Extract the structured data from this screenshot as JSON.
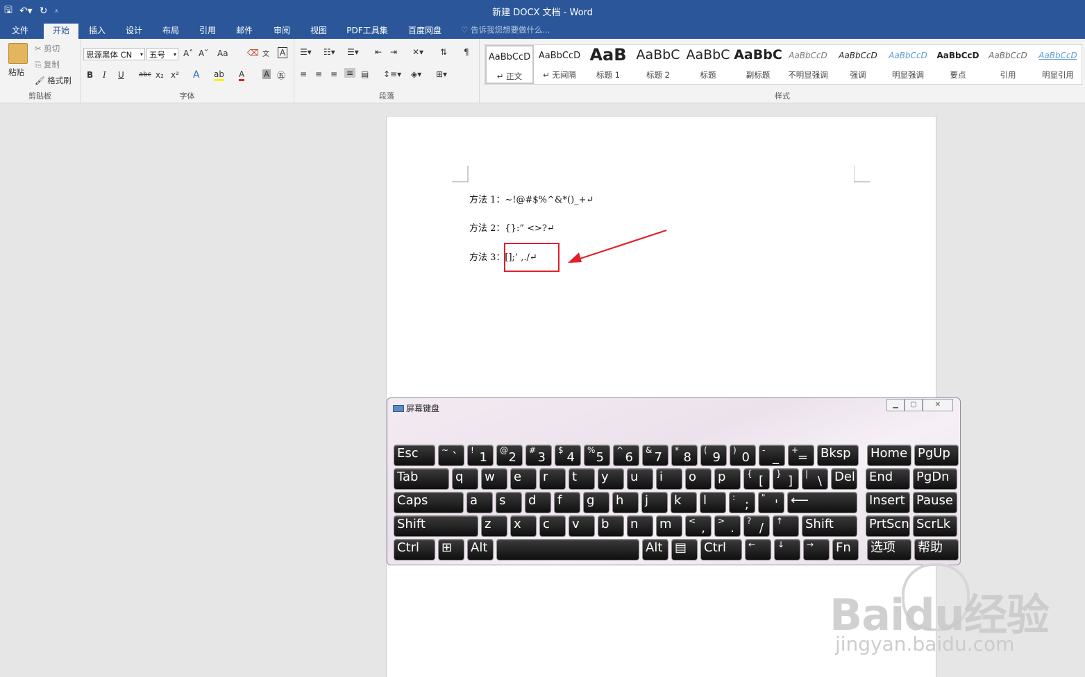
{
  "window": {
    "title": "新建 DOCX 文档 - Word"
  },
  "qat": {
    "save": "🖫",
    "undo": "↶▾",
    "redo": "↻",
    "more": "⩡"
  },
  "tabs": [
    "文件",
    "开始",
    "插入",
    "设计",
    "布局",
    "引用",
    "邮件",
    "审阅",
    "视图",
    "PDF工具集",
    "百度网盘"
  ],
  "tell_me": "告诉我您想要做什么...",
  "ribbon": {
    "clipboard": {
      "paste": "粘贴",
      "cut": "剪切",
      "copy": "复制",
      "format_painter": "格式刷",
      "label": "剪贴板"
    },
    "font": {
      "name": "思源黑体 CN",
      "size": "五号",
      "label": "字体",
      "grow": "A˄",
      "shrink": "A˅",
      "case": "Aa",
      "bold": "B",
      "italic": "I",
      "underline": "U",
      "strike": "abc",
      "sub": "x₂",
      "sup": "x²"
    },
    "paragraph": {
      "label": "段落"
    },
    "styles": {
      "label": "样式",
      "items": [
        {
          "preview": "AaBbCcD",
          "name": "↵ 正文"
        },
        {
          "preview": "AaBbCcD",
          "name": "↵ 无间隔"
        },
        {
          "preview": "AaB",
          "name": "标题 1"
        },
        {
          "preview": "AaBbC",
          "name": "标题 2"
        },
        {
          "preview": "AaBbC",
          "name": "标题"
        },
        {
          "preview": "AaBbC",
          "name": "副标题"
        },
        {
          "preview": "AaBbCcD",
          "name": "不明显强调"
        },
        {
          "preview": "AaBbCcD",
          "name": "强调"
        },
        {
          "preview": "AaBbCcD",
          "name": "明显强调"
        },
        {
          "preview": "AaBbCcD",
          "name": "要点"
        },
        {
          "preview": "AaBbCcD",
          "name": "引用"
        },
        {
          "preview": "AaBbCcD",
          "name": "明显引用"
        }
      ]
    }
  },
  "document": {
    "lines": [
      {
        "label": "方法 1：",
        "text": "~!@#$%^&*()_+↵"
      },
      {
        "label": "方法 2：",
        "text": "{}:” <>?↵"
      },
      {
        "label": "方法 3：",
        "text": "[];’ ,./↵"
      }
    ]
  },
  "osk": {
    "title": "屏幕键盘",
    "rows": [
      [
        {
          "m": "Esc"
        },
        {
          "s": "~",
          "b": "`"
        },
        {
          "s": "!",
          "b": "1"
        },
        {
          "s": "@",
          "b": "2"
        },
        {
          "s": "#",
          "b": "3"
        },
        {
          "s": "$",
          "b": "4"
        },
        {
          "s": "%",
          "b": "5"
        },
        {
          "s": "^",
          "b": "6"
        },
        {
          "s": "&",
          "b": "7"
        },
        {
          "s": "*",
          "b": "8"
        },
        {
          "s": "(",
          "b": "9"
        },
        {
          "s": ")",
          "b": "0"
        },
        {
          "s": "-",
          "b": "_"
        },
        {
          "s": "+",
          "b": "="
        },
        {
          "m": "Bksp"
        },
        {
          "m": "Home"
        },
        {
          "m": "PgUp"
        }
      ],
      [
        {
          "m": "Tab"
        },
        {
          "m": "q"
        },
        {
          "m": "w"
        },
        {
          "m": "e"
        },
        {
          "m": "r"
        },
        {
          "m": "t"
        },
        {
          "m": "y"
        },
        {
          "m": "u"
        },
        {
          "m": "i"
        },
        {
          "m": "o"
        },
        {
          "m": "p"
        },
        {
          "s": "{",
          "b": "["
        },
        {
          "s": "}",
          "b": "]"
        },
        {
          "s": "|",
          "b": "\\"
        },
        {
          "m": "Del"
        },
        {
          "m": "End"
        },
        {
          "m": "PgDn"
        }
      ],
      [
        {
          "m": "Caps"
        },
        {
          "m": "a"
        },
        {
          "m": "s"
        },
        {
          "m": "d"
        },
        {
          "m": "f"
        },
        {
          "m": "g"
        },
        {
          "m": "h"
        },
        {
          "m": "j"
        },
        {
          "m": "k"
        },
        {
          "m": "l"
        },
        {
          "s": ":",
          "b": ";"
        },
        {
          "s": "\"",
          "b": "'"
        },
        {
          "m": "⟵"
        },
        {
          "m": "Insert"
        },
        {
          "m": "Pause"
        }
      ],
      [
        {
          "m": "Shift"
        },
        {
          "m": "z"
        },
        {
          "m": "x"
        },
        {
          "m": "c"
        },
        {
          "m": "v"
        },
        {
          "m": "b"
        },
        {
          "m": "n"
        },
        {
          "m": "m"
        },
        {
          "s": "<",
          "b": ","
        },
        {
          "s": ">",
          "b": "."
        },
        {
          "s": "?",
          "b": "/"
        },
        {
          "s": "↑"
        },
        {
          "m": "Shift"
        },
        {
          "m": "PrtScn"
        },
        {
          "m": "ScrLk"
        }
      ],
      [
        {
          "m": "Ctrl"
        },
        {
          "m": "⊞"
        },
        {
          "m": "Alt"
        },
        {
          "m": ""
        },
        {
          "m": "Alt"
        },
        {
          "m": "▤"
        },
        {
          "m": "Ctrl"
        },
        {
          "s": "←"
        },
        {
          "s": "↓"
        },
        {
          "s": "→"
        },
        {
          "m": "Fn"
        },
        {
          "m": "选项"
        },
        {
          "m": "帮助"
        }
      ]
    ]
  },
  "watermark": {
    "brand": "Baidu经验",
    "url": "jingyan.baidu.com"
  },
  "colors": {
    "accent": "#2b579a",
    "highlight_box": "#e0202a"
  }
}
